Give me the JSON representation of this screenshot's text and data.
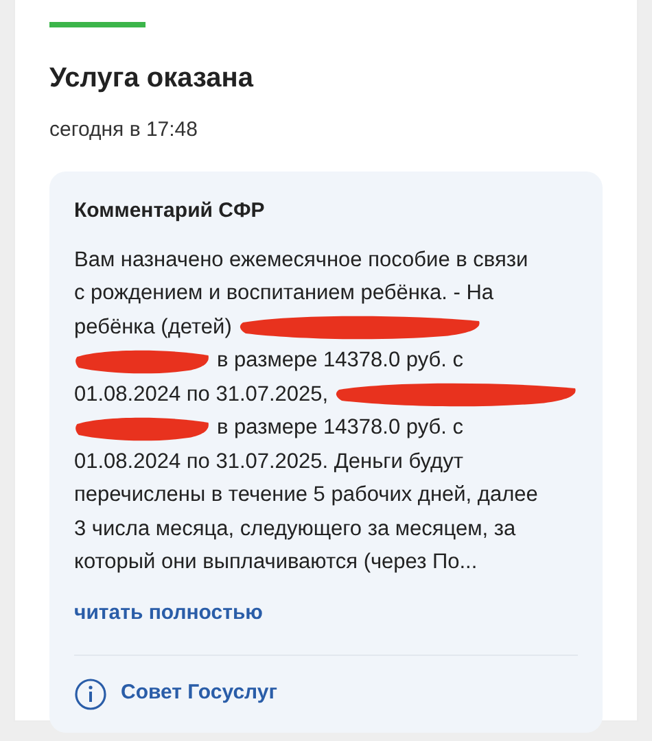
{
  "status": {
    "title": "Услуга оказана",
    "time": "сегодня в 17:48"
  },
  "comment": {
    "heading": "Комментарий СФР",
    "lines": [
      [
        {
          "kind": "text",
          "text": "Вам назначено ежемесячное пособие в связи"
        }
      ],
      [
        {
          "kind": "text",
          "text": "с рождением и воспитанием ребёнка. - На"
        }
      ],
      [
        {
          "kind": "text",
          "text": "ребёнка (детей)"
        },
        {
          "kind": "redaction"
        }
      ],
      [
        {
          "kind": "redaction"
        },
        {
          "kind": "text",
          "text": "в размере 14378.0 руб. с"
        }
      ],
      [
        {
          "kind": "text",
          "text": "01.08.2024 по 31.07.2025,"
        },
        {
          "kind": "redaction"
        }
      ],
      [
        {
          "kind": "redaction"
        },
        {
          "kind": "text",
          "text": "в размере 14378.0 руб. с"
        }
      ],
      [
        {
          "kind": "text",
          "text": "01.08.2024 по 31.07.2025. Деньги будут"
        }
      ],
      [
        {
          "kind": "text",
          "text": "перечислены в течение 5 рабочих дней, далее"
        }
      ],
      [
        {
          "kind": "text",
          "text": "3 числа месяца, следующего за месяцем, за"
        }
      ],
      [
        {
          "kind": "text",
          "text": "который они выплачиваются (через По..."
        }
      ]
    ],
    "read_more": "читать полностью"
  },
  "tip": {
    "label": "Совет Госуслуг"
  }
}
